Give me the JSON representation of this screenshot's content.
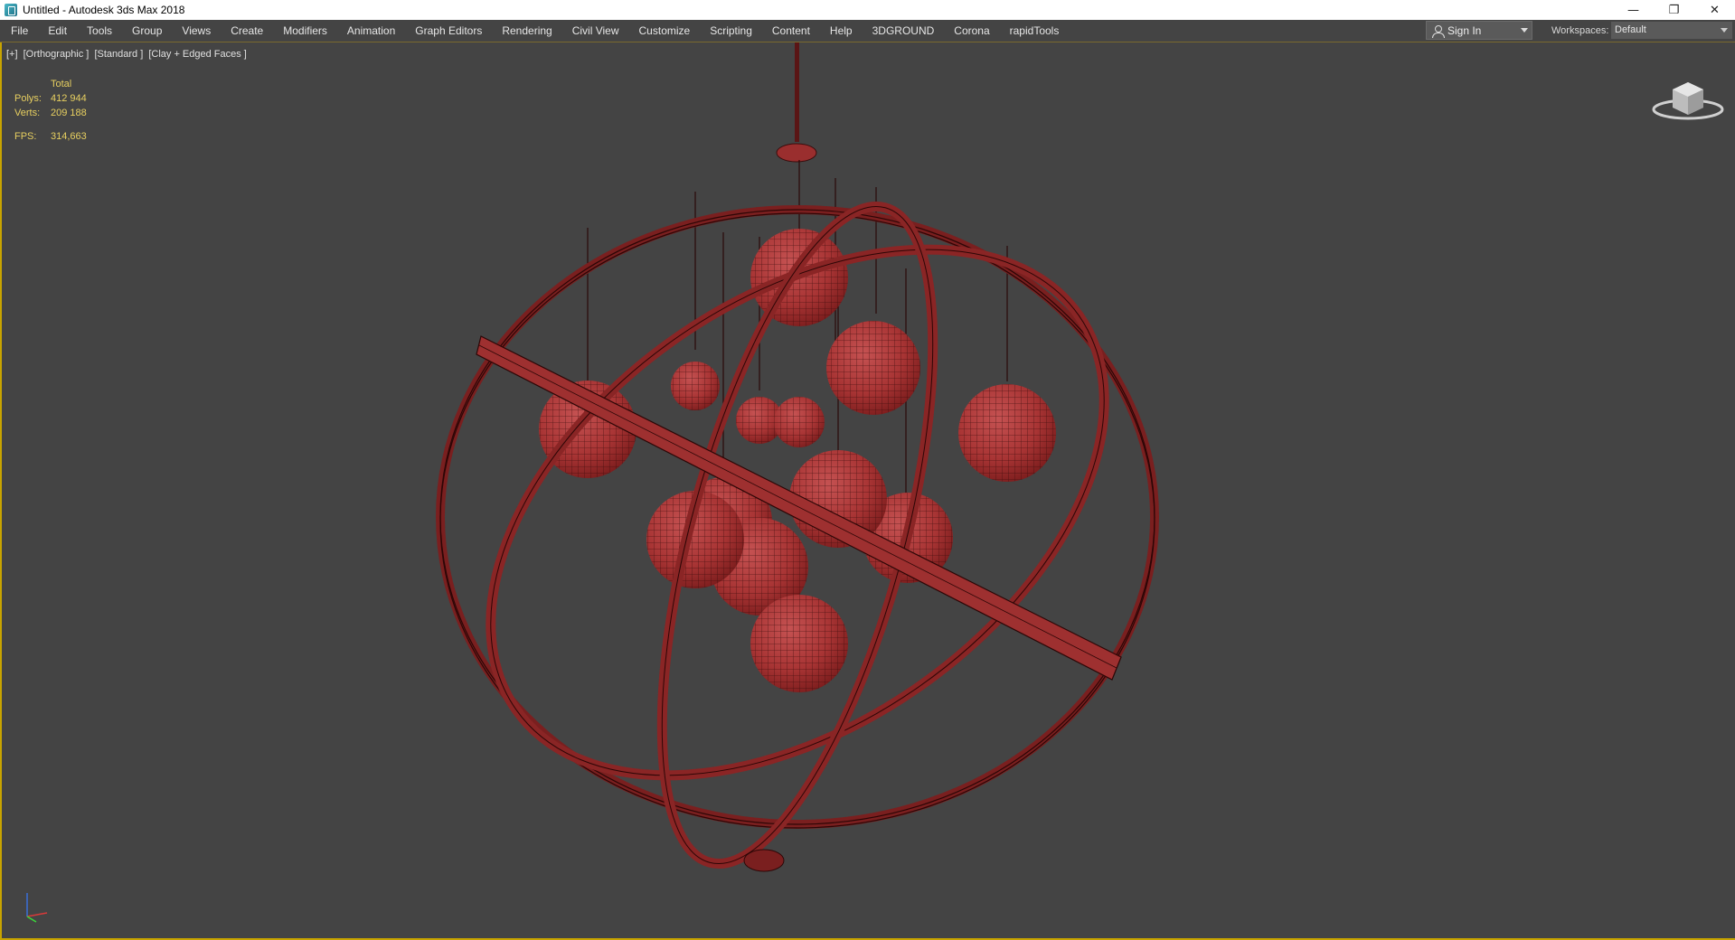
{
  "window": {
    "title": "Untitled - Autodesk 3ds Max 2018",
    "controls": {
      "minimize": "—",
      "restore": "❐",
      "close": "✕"
    }
  },
  "menu": {
    "items": [
      "File",
      "Edit",
      "Tools",
      "Group",
      "Views",
      "Create",
      "Modifiers",
      "Animation",
      "Graph Editors",
      "Rendering",
      "Civil View",
      "Customize",
      "Scripting",
      "Content",
      "Help",
      "3DGROUND",
      "Corona",
      "rapidTools"
    ],
    "sign_in": "Sign In",
    "workspaces_label": "Workspaces:",
    "workspace_value": "Default"
  },
  "viewport": {
    "labels": [
      "[+]",
      "[Orthographic ]",
      "[Standard ]",
      "[Clay + Edged Faces ]"
    ],
    "stats": {
      "header": "Total",
      "polys_label": "Polys:",
      "polys_value": "412 944",
      "verts_label": "Verts:",
      "verts_value": "209 188",
      "fps_label": "FPS:",
      "fps_value": "314,663"
    },
    "colors": {
      "background": "#444444",
      "model": "#b33a3a",
      "wire": "#3a0c0c",
      "stats_text": "#e8d060",
      "active_border": "#c8a400"
    }
  }
}
